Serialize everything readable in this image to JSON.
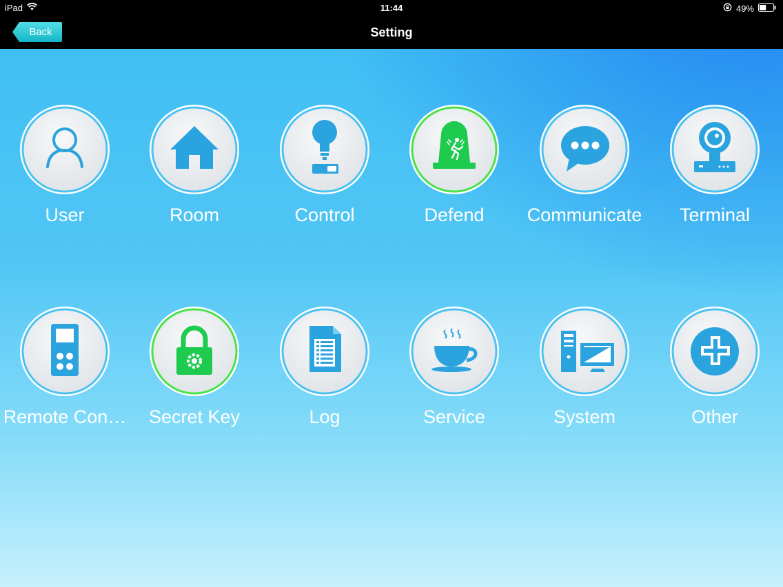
{
  "status_bar": {
    "device": "iPad",
    "time": "11:44",
    "battery": "49%",
    "battery_level": 0.49
  },
  "nav": {
    "back_label": "Back",
    "title": "Setting"
  },
  "colors": {
    "icon_blue": "#2aa3de",
    "icon_green": "#1ecb4f",
    "ring_blue": "#4cc2f2",
    "ring_green": "#4be24a",
    "back_button": "#27c3d0"
  },
  "tiles": [
    {
      "label": "User",
      "icon": "user-icon",
      "accent": "blue"
    },
    {
      "label": "Room",
      "icon": "home-icon",
      "accent": "blue"
    },
    {
      "label": "Control",
      "icon": "bulb-switch-icon",
      "accent": "blue"
    },
    {
      "label": "Defend",
      "icon": "alarm-icon",
      "accent": "green"
    },
    {
      "label": "Communicate",
      "icon": "chat-bubble-icon",
      "accent": "blue"
    },
    {
      "label": "Terminal",
      "icon": "camera-icon",
      "accent": "blue"
    },
    {
      "label": "Remote Con…",
      "icon": "remote-control-icon",
      "accent": "blue"
    },
    {
      "label": "Secret Key",
      "icon": "padlock-icon",
      "accent": "green"
    },
    {
      "label": "Log",
      "icon": "document-icon",
      "accent": "blue"
    },
    {
      "label": "Service",
      "icon": "coffee-cup-icon",
      "accent": "blue"
    },
    {
      "label": "System",
      "icon": "computer-icon",
      "accent": "blue"
    },
    {
      "label": "Other",
      "icon": "plus-icon",
      "accent": "blue"
    }
  ]
}
